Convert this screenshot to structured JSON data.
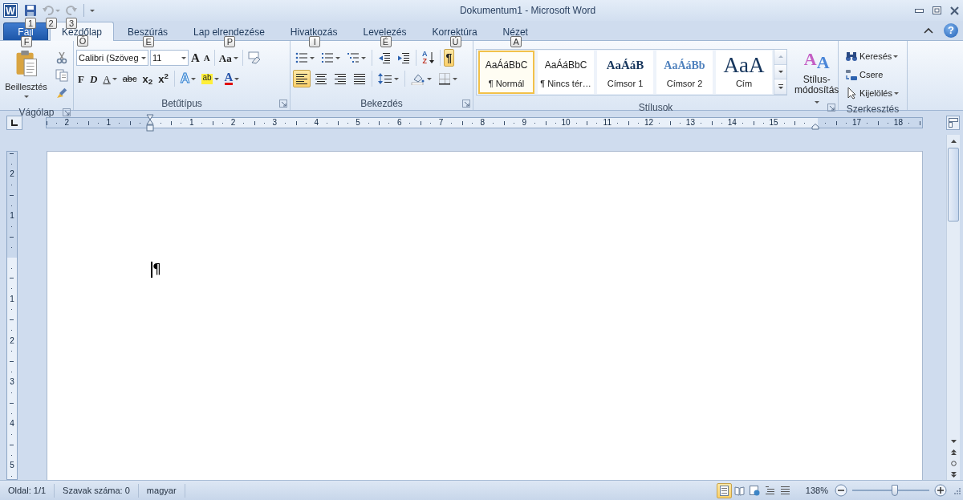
{
  "window": {
    "icon_letter": "W",
    "title": "Dokumentum1 - Microsoft Word",
    "help": "?"
  },
  "quick_access": [
    {
      "kind": "save",
      "key_tip": "1",
      "disabled": false
    },
    {
      "kind": "undo",
      "key_tip": "2",
      "disabled": true
    },
    {
      "kind": "redo",
      "key_tip": "3",
      "disabled": true
    }
  ],
  "tabs": [
    {
      "kind": "file",
      "label": "Fájl",
      "key_tip": "F",
      "selected": false
    },
    {
      "kind": "tab",
      "label": "Kezdőlap",
      "key_tip": "Ő",
      "selected": true
    },
    {
      "kind": "tab",
      "label": "Beszúrás",
      "key_tip": "E",
      "selected": false
    },
    {
      "kind": "tab",
      "label": "Lap elrendezése",
      "key_tip": "P",
      "selected": false
    },
    {
      "kind": "tab",
      "label": "Hivatkozás",
      "key_tip": "I",
      "selected": false
    },
    {
      "kind": "tab",
      "label": "Levelezés",
      "key_tip": "É",
      "selected": false
    },
    {
      "kind": "tab",
      "label": "Korrektúra",
      "key_tip": "Ú",
      "selected": false
    },
    {
      "kind": "tab",
      "label": "Nézet",
      "key_tip": "A",
      "selected": false
    }
  ],
  "clipboard": {
    "paste": "Beillesztés",
    "label": "Vágólap",
    "launcher": true
  },
  "font": {
    "name": "Calibri (Szöveg",
    "size": "11",
    "label": "Betűtípus",
    "launcher": true,
    "row1": [
      {
        "kind": "grow",
        "glyph": "A"
      },
      {
        "kind": "shrink",
        "glyph": "A"
      },
      {
        "kind": "case",
        "glyph": "Aa"
      },
      {
        "kind": "clear"
      }
    ],
    "row2": [
      {
        "kind": "bold",
        "glyph": "F"
      },
      {
        "kind": "italic",
        "glyph": "D"
      },
      {
        "kind": "underline",
        "glyph": "A"
      },
      {
        "kind": "strike",
        "glyph": "abc"
      },
      {
        "kind": "subscript",
        "glyph": "x$_{2}$"
      },
      {
        "kind": "superscript",
        "glyph": "x$^{2}$"
      },
      {
        "kind": "effects",
        "glyph": "A"
      },
      {
        "kind": "highlight",
        "glyph": "ab"
      },
      {
        "kind": "color",
        "glyph": "A"
      }
    ]
  },
  "paragraph": {
    "label": "Bekezdés",
    "launcher": true,
    "row1": [
      {
        "kind": "bullets",
        "selected": false
      },
      {
        "kind": "numbering",
        "selected": false
      },
      {
        "kind": "multilevel",
        "selected": false
      },
      {
        "kind": "outdent",
        "selected": false
      },
      {
        "kind": "indent",
        "selected": false
      },
      {
        "kind": "sort",
        "glyph_top": "A",
        "glyph_bottom": "Z",
        "selected": false
      },
      {
        "kind": "marks",
        "glyph": "¶",
        "selected": true
      }
    ],
    "row2": [
      {
        "kind": "align-left",
        "selected": true
      },
      {
        "kind": "align-center",
        "selected": false
      },
      {
        "kind": "align-right",
        "selected": false
      },
      {
        "kind": "justify",
        "selected": false
      },
      {
        "kind": "spacing",
        "selected": false
      },
      {
        "kind": "shading",
        "selected": false
      },
      {
        "kind": "borders",
        "selected": false
      }
    ]
  },
  "styles": {
    "label": "Stílusok",
    "launcher": true,
    "change": "Stílus-módosítás",
    "change_glyphs": [
      "A",
      "A"
    ],
    "items": [
      {
        "kind": "normal",
        "preview": "AaÁáBbC",
        "label": "¶ Normál",
        "selected": true
      },
      {
        "kind": "nospace",
        "preview": "AaÁáBbC",
        "label": "¶ Nincs tér…",
        "selected": false
      },
      {
        "kind": "h1",
        "preview": "AaÁáB",
        "label": "Címsor 1",
        "selected": false
      },
      {
        "kind": "h2",
        "preview": "AaÁáBb",
        "label": "Címsor 2",
        "selected": false
      },
      {
        "kind": "title",
        "preview": "AaA",
        "label": "Cím",
        "selected": false
      }
    ]
  },
  "editing": {
    "label": "Szerkesztés",
    "launcher": false,
    "items": [
      {
        "kind": "find",
        "label": "Keresés",
        "dropdown": true
      },
      {
        "kind": "replace",
        "label": "Csere",
        "dropdown": false
      },
      {
        "kind": "select",
        "label": "Kijelölés",
        "dropdown": true
      }
    ]
  },
  "ruler": {
    "left_labels": [
      "2",
      "1"
    ],
    "labels": [
      "1",
      "2",
      "3",
      "4",
      "5",
      "6",
      "7",
      "8",
      "9",
      "10",
      "11",
      "12",
      "13",
      "14",
      "15"
    ],
    "right_labels": [
      "17",
      "18"
    ]
  },
  "vertical_ruler": {
    "top_labels": [
      "2",
      "1"
    ],
    "labels": [
      "1",
      "2",
      "3",
      "4",
      "5"
    ]
  },
  "document": {
    "paragraph_mark": "¶"
  },
  "status_bar": {
    "items": [
      "Oldal: 1/1",
      "Szavak száma: 0",
      "magyar"
    ],
    "views": [
      {
        "kind": "print",
        "selected": true
      },
      {
        "kind": "reading",
        "selected": false
      },
      {
        "kind": "web",
        "selected": false
      },
      {
        "kind": "outline",
        "selected": false
      },
      {
        "kind": "draft",
        "selected": false
      }
    ],
    "zoom": "138%",
    "zoom_slider": {
      "level": 0.55
    }
  }
}
